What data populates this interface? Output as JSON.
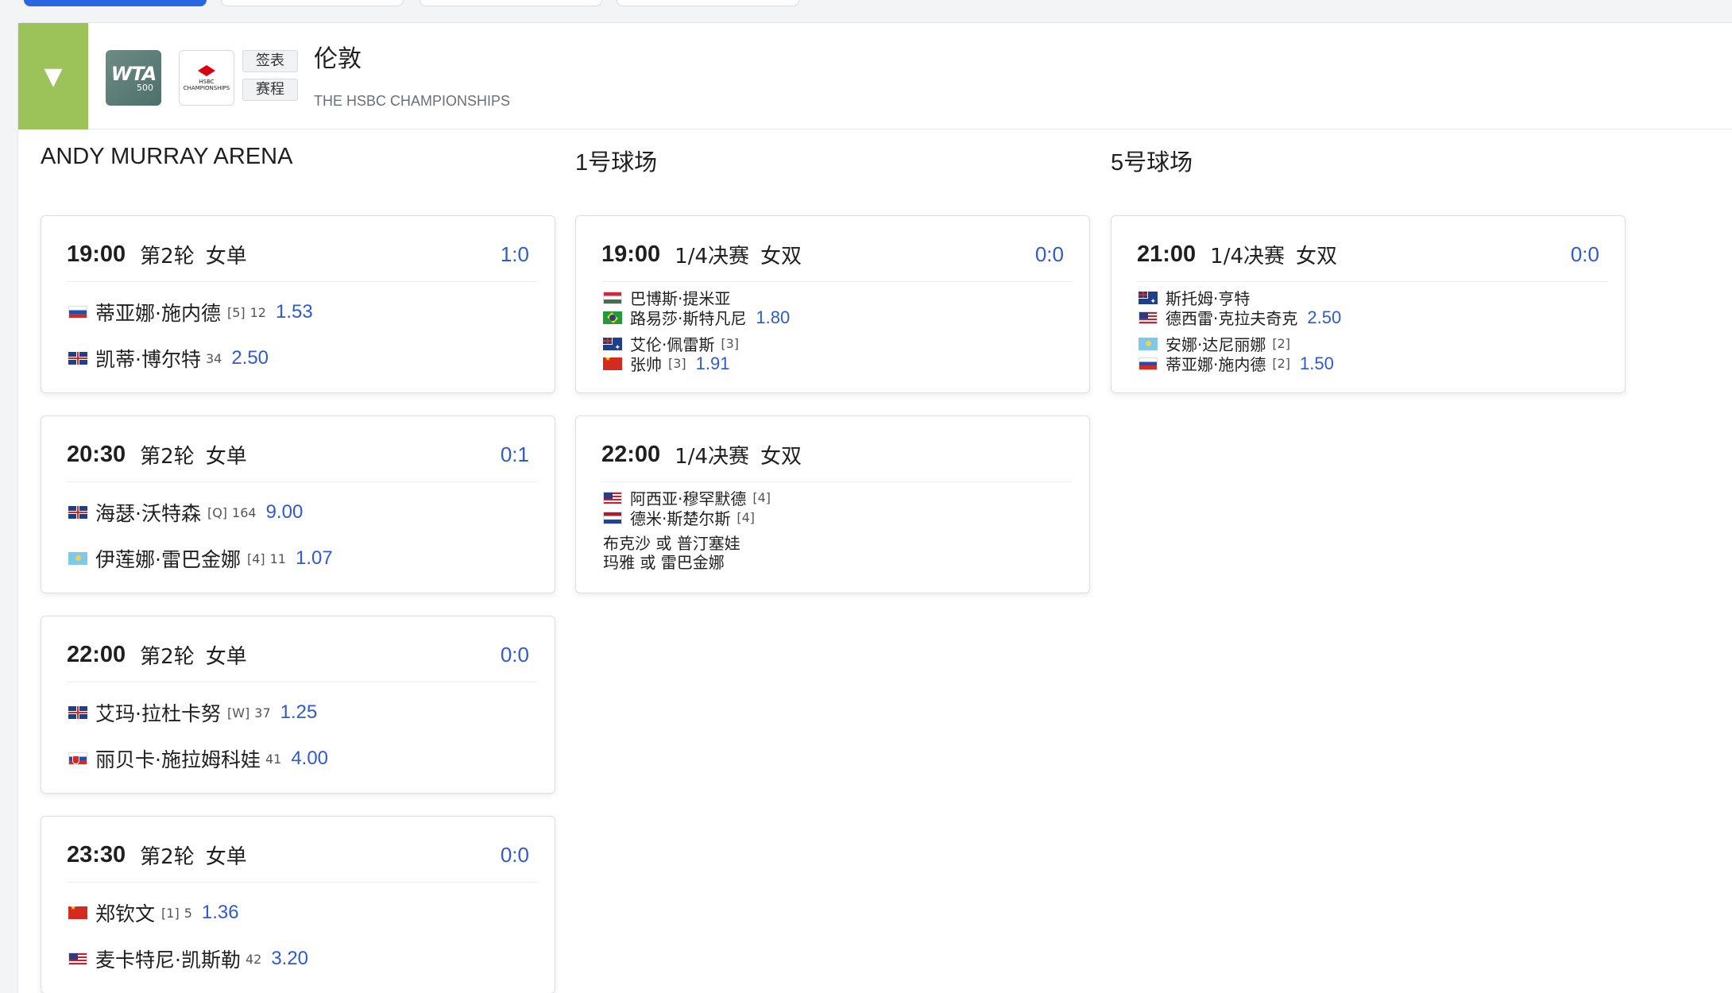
{
  "header": {
    "city": "伦敦",
    "event_name": "THE HSBC CHAMPIONSHIPS",
    "buttons": {
      "draw": "签表",
      "schedule": "赛程"
    },
    "wta_logo": {
      "main": "WTA",
      "sub": "500"
    },
    "sponsor_logo": {
      "line1": "HSBC",
      "line2": "CHAMPIONSHIPS"
    },
    "toggle_icon": "▼"
  },
  "courts": [
    {
      "name": "ANDY MURRAY ARENA",
      "matches": [
        {
          "time": "19:00",
          "round": "第2轮",
          "kind": "女单",
          "score": "1:0",
          "players": [
            {
              "flag": "ru",
              "name": "蒂亚娜·施内德",
              "seed": "[5]",
              "rank": "12",
              "odds": "1.53"
            },
            {
              "flag": "gb",
              "name": "凯蒂·博尔特",
              "seed": "",
              "rank": "34",
              "odds": "2.50"
            }
          ]
        },
        {
          "time": "20:30",
          "round": "第2轮",
          "kind": "女单",
          "score": "0:1",
          "players": [
            {
              "flag": "gb",
              "name": "海瑟·沃特森",
              "seed": "[Q]",
              "rank": "164",
              "odds": "9.00"
            },
            {
              "flag": "kz",
              "name": "伊莲娜·雷巴金娜",
              "seed": "[4]",
              "rank": "11",
              "odds": "1.07"
            }
          ]
        },
        {
          "time": "22:00",
          "round": "第2轮",
          "kind": "女单",
          "score": "0:0",
          "players": [
            {
              "flag": "gb",
              "name": "艾玛·拉杜卡努",
              "seed": "[W]",
              "rank": "37",
              "odds": "1.25"
            },
            {
              "flag": "sk",
              "name": "丽贝卡·施拉姆科娃",
              "seed": "",
              "rank": "41",
              "odds": "4.00"
            }
          ]
        },
        {
          "time": "23:30",
          "round": "第2轮",
          "kind": "女单",
          "score": "0:0",
          "players": [
            {
              "flag": "cn",
              "name": "郑钦文",
              "seed": "[1]",
              "rank": "5",
              "odds": "1.36"
            },
            {
              "flag": "us",
              "name": "麦卡特尼·凯斯勒",
              "seed": "",
              "rank": "42",
              "odds": "3.20"
            }
          ]
        }
      ]
    },
    {
      "name": "1号球场",
      "matches": [
        {
          "time": "19:00",
          "round": "1/4决赛",
          "kind": "女双",
          "score": "0:0",
          "teams": [
            {
              "players": [
                {
                  "flag": "hu",
                  "name": "巴博斯·提米亚",
                  "seed": ""
                },
                {
                  "flag": "br",
                  "name": "路易莎·斯特凡尼",
                  "seed": ""
                }
              ],
              "odds": "1.80"
            },
            {
              "players": [
                {
                  "flag": "au",
                  "name": "艾伦·佩雷斯",
                  "seed": "[3]"
                },
                {
                  "flag": "cn",
                  "name": "张帅",
                  "seed": "[3]"
                }
              ],
              "odds": "1.91"
            }
          ]
        },
        {
          "time": "22:00",
          "round": "1/4决赛",
          "kind": "女双",
          "score": "",
          "teams": [
            {
              "players": [
                {
                  "flag": "us",
                  "name": "阿西亚·穆罕默德",
                  "seed": "[4]"
                },
                {
                  "flag": "nl",
                  "name": "德米·斯楚尔斯",
                  "seed": "[4]"
                }
              ],
              "odds": ""
            }
          ],
          "tbd": [
            "布克沙 或 普汀塞娃",
            "玛雅 或 雷巴金娜"
          ]
        }
      ]
    },
    {
      "name": "5号球场",
      "matches": [
        {
          "time": "21:00",
          "round": "1/4决赛",
          "kind": "女双",
          "score": "0:0",
          "teams": [
            {
              "players": [
                {
                  "flag": "au",
                  "name": "斯托姆·亨特",
                  "seed": ""
                },
                {
                  "flag": "us",
                  "name": "德西雷·克拉夫奇克",
                  "seed": ""
                }
              ],
              "odds": "2.50"
            },
            {
              "players": [
                {
                  "flag": "kz",
                  "name": "安娜·达尼丽娜",
                  "seed": "[2]"
                },
                {
                  "flag": "ru",
                  "name": "蒂亚娜·施内德",
                  "seed": "[2]"
                }
              ],
              "odds": "1.50"
            }
          ]
        }
      ]
    }
  ]
}
